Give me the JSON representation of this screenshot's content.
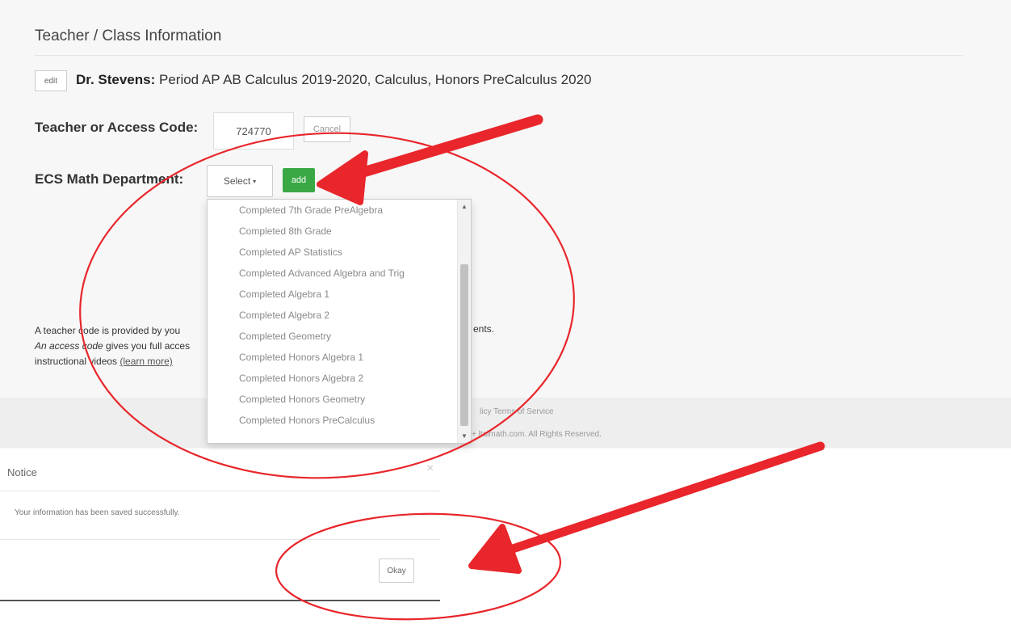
{
  "section_title": "Teacher / Class Information",
  "teacher": {
    "edit_label": "edit",
    "name": "Dr. Stevens:",
    "classes": " Period AP AB Calculus 2019-2020, Calculus, Honors PreCalculus 2020"
  },
  "access_code": {
    "label": "Teacher or Access Code:",
    "value": "724770",
    "cancel_label": "Cancel"
  },
  "department": {
    "label": "ECS Math Department:",
    "select_label": "Select",
    "add_label": "add",
    "options": [
      "Completed 7th Grade PreAlgebra",
      "Completed 8th Grade",
      "Completed AP Statistics",
      "Completed Advanced Algebra and Trig",
      "Completed Algebra 1",
      "Completed Algebra 2",
      "Completed Geometry",
      "Completed Honors Algebra 1",
      "Completed Honors Algebra 2",
      "Completed Honors Geometry",
      "Completed Honors PreCalculus"
    ]
  },
  "help": {
    "line1": "A teacher code is provided by you",
    "line1_end": "ents.",
    "line2_em": "An access code",
    "line2": " gives you full acces",
    "line3": "instructional videos ",
    "learn_more": "(learn more)"
  },
  "footer": {
    "links": "licy   Terms of Service",
    "copyright": "+ ltalmath.com. All Rights Reserved."
  },
  "notice": {
    "title": "Notice",
    "close": "×",
    "message": "Your information has been saved successfully.",
    "okay_label": "Okay"
  },
  "colors": {
    "add_button": "#3aa845",
    "annotation_red": "#e8262b"
  }
}
